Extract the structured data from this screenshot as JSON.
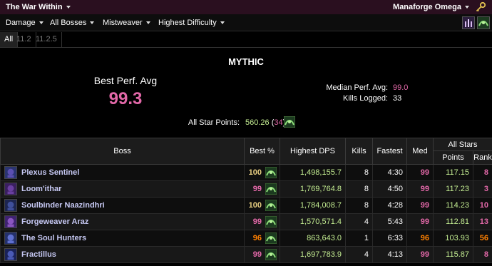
{
  "topbar": {
    "zone": "The War Within",
    "realm": "Manaforge Omega"
  },
  "filters": {
    "metric": "Damage",
    "boss": "All Bosses",
    "spec": "Mistweaver",
    "difficulty": "Highest Difficulty"
  },
  "tabs": [
    "All",
    "11.2",
    "11.2.5"
  ],
  "summary": {
    "heading": "MYTHIC",
    "best_perf_label": "Best Perf. Avg",
    "best_perf_value": "99.3",
    "median_label": "Median Perf. Avg:",
    "median_value": "99.0",
    "kills_label": "Kills Logged:",
    "kills_value": "33",
    "all_star_label": "All Star Points:",
    "all_star_points": "560.26",
    "all_star_rank": "34"
  },
  "table": {
    "headers": {
      "boss": "Boss",
      "best": "Best %",
      "dps": "Highest DPS",
      "kills": "Kills",
      "fastest": "Fastest",
      "med": "Med",
      "all_stars": "All Stars",
      "points": "Points",
      "rank": "Rank"
    },
    "rows": [
      {
        "boss": "Plexus Sentinel",
        "best": "100",
        "dps": "1,498,155.7",
        "kills": "8",
        "fastest": "4:30",
        "med": "99",
        "points": "117.15",
        "rank": "8"
      },
      {
        "boss": "Loom'ithar",
        "best": "99",
        "dps": "1,769,764.8",
        "kills": "8",
        "fastest": "4:50",
        "med": "99",
        "points": "117.23",
        "rank": "3"
      },
      {
        "boss": "Soulbinder Naazindhri",
        "best": "100",
        "dps": "1,784,008.7",
        "kills": "8",
        "fastest": "4:28",
        "med": "99",
        "points": "114.23",
        "rank": "10"
      },
      {
        "boss": "Forgeweaver Araz",
        "best": "99",
        "dps": "1,570,571.4",
        "kills": "4",
        "fastest": "5:43",
        "med": "99",
        "points": "112.81",
        "rank": "13"
      },
      {
        "boss": "The Soul Hunters",
        "best": "96",
        "dps": "863,643.0",
        "kills": "1",
        "fastest": "6:33",
        "med": "96",
        "points": "103.93",
        "rank": "56"
      },
      {
        "boss": "Fractillus",
        "best": "99",
        "dps": "1,697,783.9",
        "kills": "4",
        "fastest": "4:13",
        "med": "99",
        "points": "115.87",
        "rank": "8"
      }
    ]
  },
  "colors": {
    "background": "#000000",
    "topbar": "#2a0f1f",
    "legendary_pink": "#e268a8",
    "gold": "#e5cc80",
    "orange": "#ff8000",
    "green_text": "#c3ec91",
    "boss_name": "#c7c9f4"
  }
}
